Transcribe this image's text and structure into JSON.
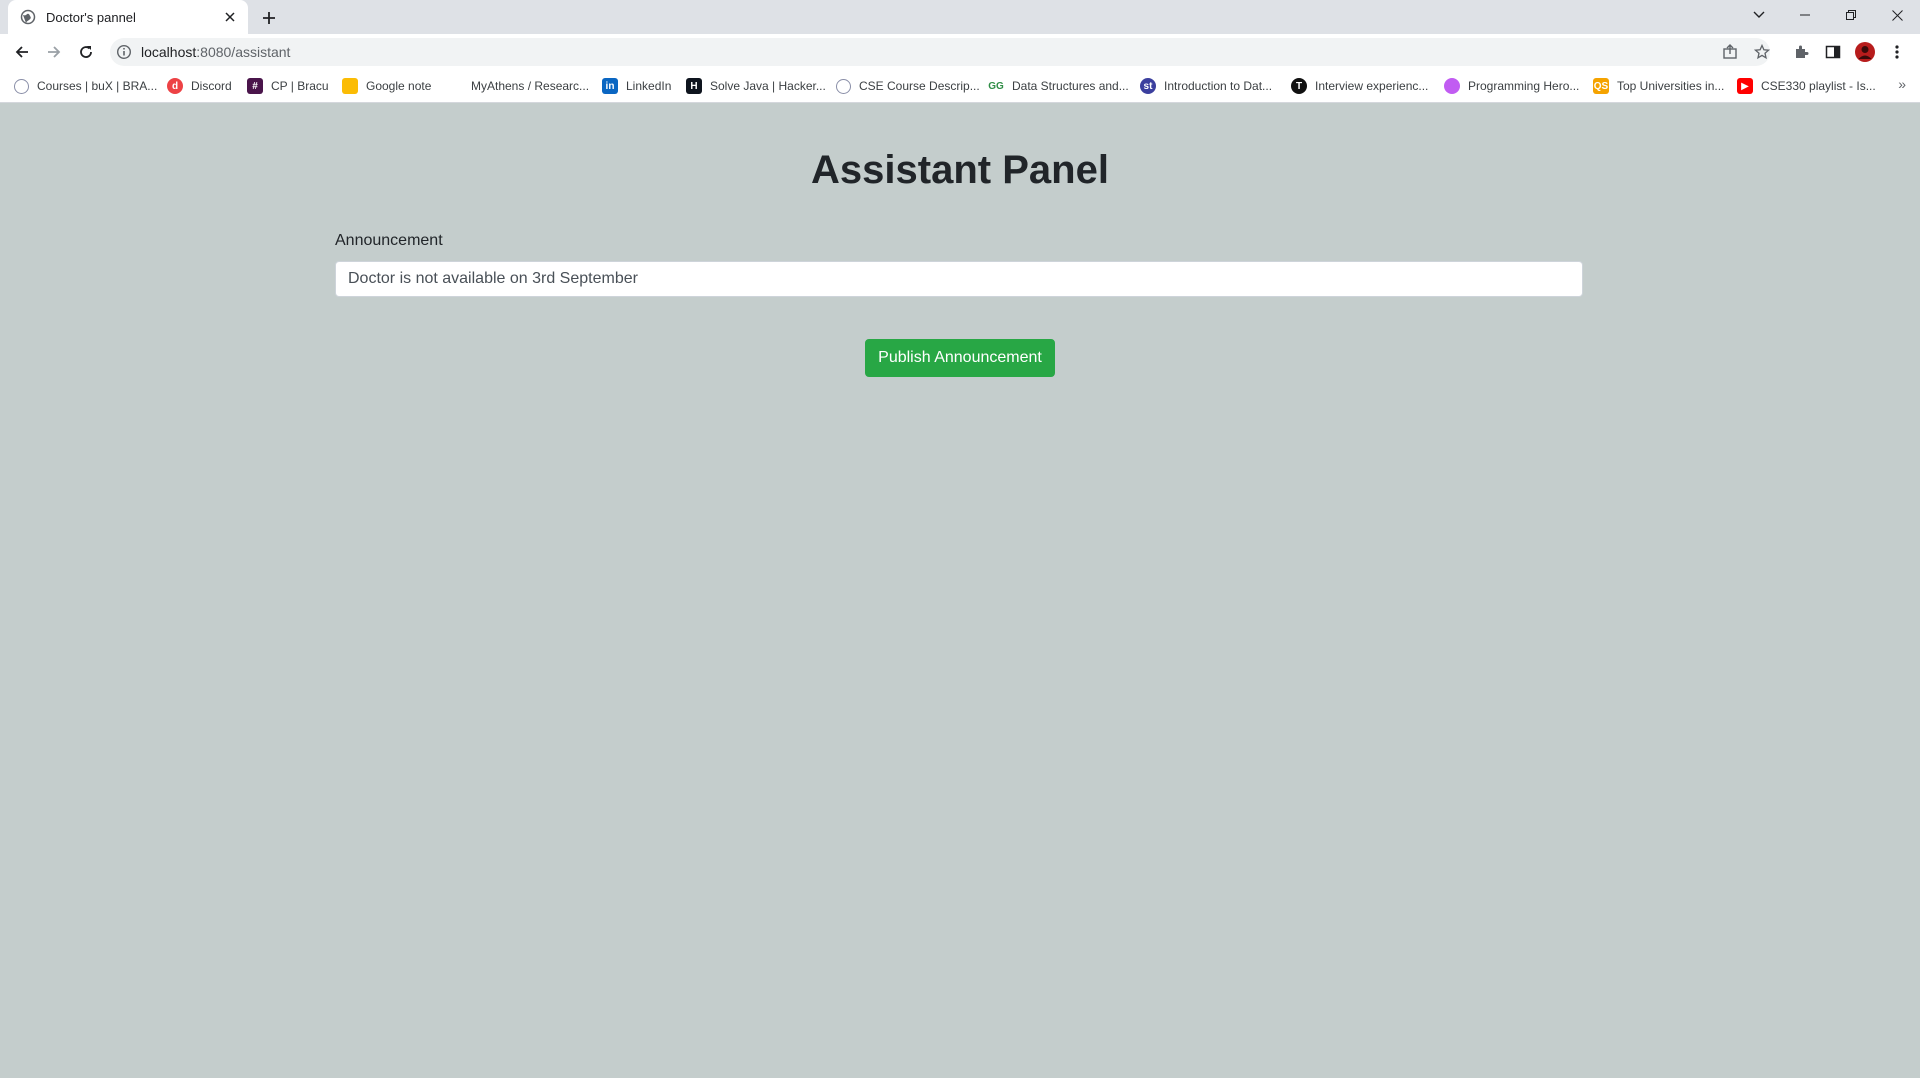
{
  "browser": {
    "tab_title": "Doctor's pannel",
    "url_host": "localhost",
    "url_path": ":8080/assistant"
  },
  "bookmarks": [
    {
      "label": "Courses | buX | BRA...",
      "icon": "globe-icon",
      "color": "#8a8fa8"
    },
    {
      "label": "Discord",
      "icon": "discord-icon",
      "color": "#ed4245"
    },
    {
      "label": "CP | Bracu",
      "icon": "slack-icon",
      "color": "#4a154b"
    },
    {
      "label": "Google note",
      "icon": "google-keep-icon",
      "color": "#fbbc04"
    },
    {
      "label": "MyAthens / Researc...",
      "icon": "athens-icon",
      "color": "#7aa36b"
    },
    {
      "label": "LinkedIn",
      "icon": "linkedin-icon",
      "color": "#0a66c2"
    },
    {
      "label": "Solve Java | Hacker...",
      "icon": "hackerrank-icon",
      "color": "#0e141e"
    },
    {
      "label": "CSE Course Descrip...",
      "icon": "globe-icon",
      "color": "#8a8fa8"
    },
    {
      "label": "Data Structures and...",
      "icon": "gfg-icon",
      "color": "#2f8d46"
    },
    {
      "label": "Introduction to Dat...",
      "icon": "studytonight-icon",
      "color": "#3b3f9e"
    },
    {
      "label": "Interview experienc...",
      "icon": "t-icon",
      "color": "#111111"
    },
    {
      "label": "Programming Hero...",
      "icon": "programming-hero-icon",
      "color": "#c15cf2"
    },
    {
      "label": "Top Universities in...",
      "icon": "qs-icon",
      "color": "#f5a300"
    },
    {
      "label": "CSE330 playlist - Is...",
      "icon": "youtube-icon",
      "color": "#ff0000"
    }
  ],
  "main": {
    "title": "Assistant Panel",
    "announcement_label": "Announcement",
    "announcement_value": "Doctor is not available on 3rd September",
    "publish_label": "Publish Announcement"
  },
  "colors": {
    "page_background": "#c4cdcc",
    "publish_button": "#28a745"
  }
}
